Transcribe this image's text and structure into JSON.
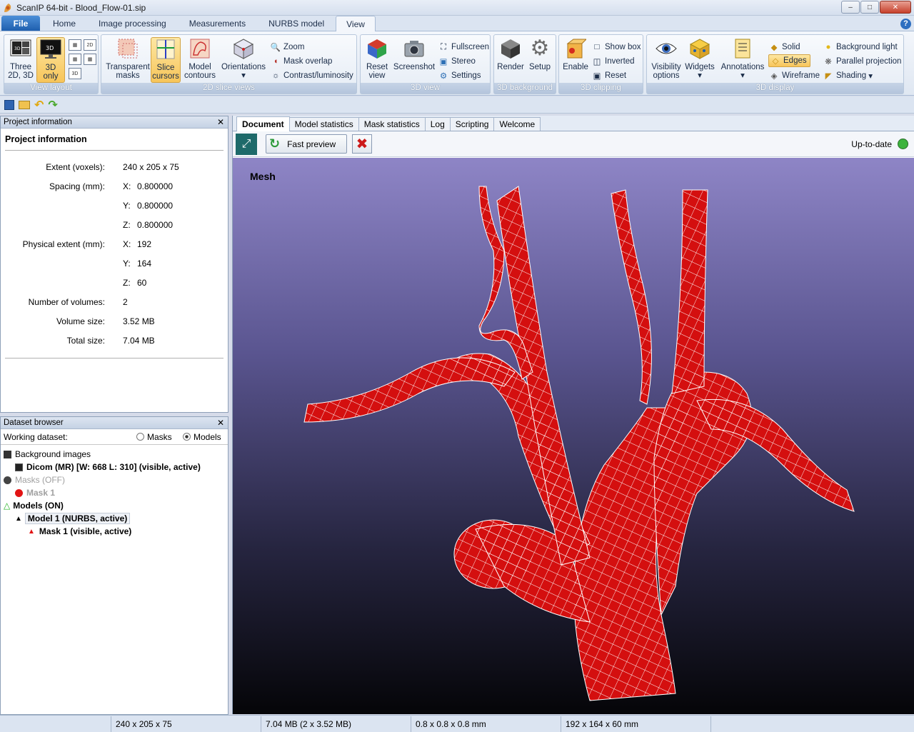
{
  "window": {
    "title": "ScanIP 64-bit - Blood_Flow-01.sip"
  },
  "ribbon_tabs": [
    "File",
    "Home",
    "Image processing",
    "Measurements",
    "NURBS model",
    "View"
  ],
  "ribbon": {
    "view_layout": {
      "label": "View layout",
      "three": "Three",
      "three2": "2D, 3D",
      "only3d": "3D",
      "only3d2": "only",
      "mini_2d": "2D",
      "mini_3d": "3D"
    },
    "slice_views": {
      "label": "2D slice views",
      "transparent": "Transparent",
      "transparent2": "masks",
      "slice": "Slice",
      "slice2": "cursors",
      "model": "Model",
      "model2": "contours",
      "orientations": "Orientations",
      "zoom": "Zoom",
      "mask_overlap": "Mask overlap",
      "contrast": "Contrast/luminosity"
    },
    "view3d": {
      "label": "3D view",
      "reset": "Reset",
      "reset2": "view",
      "screenshot": "Screenshot",
      "fullscreen": "Fullscreen",
      "stereo": "Stereo",
      "settings": "Settings"
    },
    "background": {
      "label": "3D background",
      "render": "Render",
      "setup": "Setup"
    },
    "clipping": {
      "label": "3D clipping",
      "enable": "Enable",
      "show_box": "Show box",
      "inverted": "Inverted",
      "reset": "Reset"
    },
    "display": {
      "label": "3D display",
      "visibility": "Visibility",
      "visibility2": "options",
      "widgets": "Widgets",
      "annotations": "Annotations",
      "solid": "Solid",
      "edges": "Edges",
      "wireframe": "Wireframe",
      "bg_light": "Background light",
      "parallel": "Parallel projection",
      "shading": "Shading"
    }
  },
  "project_info": {
    "panel_title": "Project information",
    "heading": "Project information",
    "rows": [
      {
        "label": "Extent (voxels):",
        "axis": "",
        "value": "240 x 205 x 75"
      },
      {
        "label": "Spacing (mm):",
        "axis": "X:",
        "value": "0.800000"
      },
      {
        "label": "",
        "axis": "Y:",
        "value": "0.800000"
      },
      {
        "label": "",
        "axis": "Z:",
        "value": "0.800000"
      },
      {
        "label": "Physical extent (mm):",
        "axis": "X:",
        "value": "192"
      },
      {
        "label": "",
        "axis": "Y:",
        "value": "164"
      },
      {
        "label": "",
        "axis": "Z:",
        "value": "60"
      },
      {
        "label": "Number of volumes:",
        "axis": "",
        "value": "2"
      },
      {
        "label": "Volume size:",
        "axis": "",
        "value": "3.52 MB"
      },
      {
        "label": "Total size:",
        "axis": "",
        "value": "7.04 MB"
      }
    ]
  },
  "dataset_browser": {
    "panel_title": "Dataset browser",
    "working_label": "Working dataset:",
    "opt_masks": "Masks",
    "opt_models": "Models",
    "tree": [
      {
        "text": "Background images",
        "bold": false,
        "grey": false
      },
      {
        "text": "Dicom  (MR) [W: 668 L: 310] (visible, active)",
        "bold": true,
        "grey": false
      },
      {
        "text": "Masks (OFF)",
        "bold": false,
        "grey": true
      },
      {
        "text": "Mask 1",
        "bold": true,
        "grey": true
      },
      {
        "text": "Models (ON)",
        "bold": true,
        "grey": false
      },
      {
        "text": "Model 1 (NURBS, active)",
        "bold": true,
        "grey": false
      },
      {
        "text": "Mask 1 (visible, active)",
        "bold": true,
        "grey": false
      }
    ]
  },
  "doc_tabs": [
    "Document",
    "Model statistics",
    "Mask statistics",
    "Log",
    "Scripting",
    "Welcome"
  ],
  "doc_toolbar": {
    "fast_preview": "Fast preview",
    "status": "Up-to-date",
    "status_color": "#3db33d"
  },
  "viewport": {
    "label": "Mesh",
    "mesh_color": "#d40f0f"
  },
  "statusbar": [
    "240 x 205 x 75",
    "7.04 MB (2 x 3.52 MB)",
    "0.8 x 0.8 x 0.8 mm",
    "192 x 164 x 60 mm"
  ]
}
